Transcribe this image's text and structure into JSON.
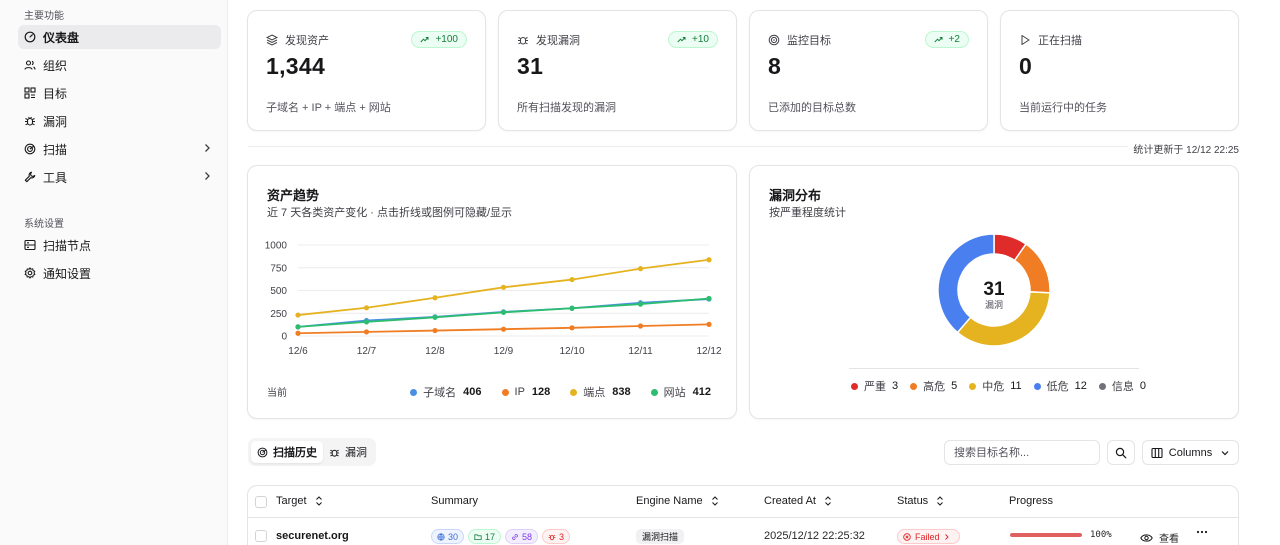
{
  "sidebar": {
    "section_main": "主要功能",
    "section_system": "系统设置",
    "items": [
      {
        "label": "仪表盘",
        "icon": "dashboard-icon"
      },
      {
        "label": "组织",
        "icon": "users-icon"
      },
      {
        "label": "目标",
        "icon": "grid-icon"
      },
      {
        "label": "漏洞",
        "icon": "bug-icon"
      },
      {
        "label": "扫描",
        "icon": "radar-icon"
      },
      {
        "label": "工具",
        "icon": "wrench-icon"
      }
    ],
    "system_items": [
      {
        "label": "扫描节点",
        "icon": "server-icon"
      },
      {
        "label": "通知设置",
        "icon": "gear-icon"
      }
    ]
  },
  "stats": [
    {
      "title": "发现资产",
      "value": "1,344",
      "desc": "子域名 + IP + 端点 + 网站",
      "badge": "+100",
      "icon": "layers-icon"
    },
    {
      "title": "发现漏洞",
      "value": "31",
      "desc": "所有扫描发现的漏洞",
      "badge": "+10",
      "icon": "bug-icon"
    },
    {
      "title": "监控目标",
      "value": "8",
      "desc": "已添加的目标总数",
      "badge": "+2",
      "icon": "target-icon"
    },
    {
      "title": "正在扫描",
      "value": "0",
      "desc": "当前运行中的任务",
      "icon": "play-icon"
    }
  ],
  "stats_updated": "统计更新于 12/12 22:25",
  "asset_trend": {
    "title": "资产趋势",
    "subtitle": "近 7 天各类资产变化 · 点击折线或图例可隐藏/显示",
    "current_label": "当前"
  },
  "vuln_dist": {
    "title": "漏洞分布",
    "subtitle": "按严重程度统计",
    "center_value": "31",
    "center_label": "漏洞"
  },
  "chart_data": [
    {
      "type": "line",
      "x": [
        "12/6",
        "12/7",
        "12/8",
        "12/9",
        "12/10",
        "12/11",
        "12/12"
      ],
      "ylim": [
        0,
        1000
      ],
      "yticks": [
        "0",
        "250",
        "500",
        "750",
        "1000"
      ],
      "grid": true,
      "legend_position": "bottom",
      "series": [
        {
          "name": "子域名",
          "current": "406",
          "color": "#4a90e2",
          "values": [
            100,
            170,
            210,
            265,
            305,
            365,
            406
          ]
        },
        {
          "name": "IP",
          "current": "128",
          "color": "#f07d23",
          "values": [
            30,
            45,
            60,
            75,
            90,
            110,
            128
          ]
        },
        {
          "name": "端点",
          "current": "838",
          "color": "#e5b320",
          "values": [
            230,
            310,
            420,
            535,
            620,
            740,
            838
          ]
        },
        {
          "name": "网站",
          "current": "412",
          "color": "#2dbd6e",
          "values": [
            100,
            155,
            205,
            260,
            305,
            350,
            412
          ]
        }
      ]
    },
    {
      "type": "pie",
      "donut": true,
      "legend_position": "bottom",
      "categories": [
        "严重",
        "高危",
        "中危",
        "低危",
        "信息"
      ],
      "values": [
        3,
        5,
        11,
        12,
        0
      ],
      "labels": [
        "3",
        "5",
        "11",
        "12",
        "0"
      ],
      "colors": [
        "#e02b2b",
        "#f07d23",
        "#e5b320",
        "#4a7ff0",
        "#71717a"
      ]
    }
  ],
  "toolbar": {
    "tab_history": "扫描历史",
    "tab_vulns": "漏洞",
    "search_placeholder": "搜索目标名称...",
    "columns_label": "Columns"
  },
  "table": {
    "headers": [
      "Target",
      "Summary",
      "Engine Name",
      "Created At",
      "Status",
      "Progress"
    ],
    "rows": [
      {
        "target": "securenet.org",
        "summary": [
          {
            "value": "30",
            "icon": "globe-icon",
            "color": "#3b6fd8",
            "bg": "#eef3fe",
            "border": "#c7d7fb"
          },
          {
            "value": "17",
            "icon": "folder-icon",
            "color": "#15803d",
            "bg": "#ecfdf3",
            "border": "#bbf7d0"
          },
          {
            "value": "58",
            "icon": "link-icon",
            "color": "#7c3aed",
            "bg": "#f3eefe",
            "border": "#ddd0fb"
          },
          {
            "value": "3",
            "icon": "bug-icon",
            "color": "#dc2626",
            "bg": "#fef2f2",
            "border": "#fecaca"
          }
        ],
        "engine": "漏洞扫描",
        "created_at": "2025/12/12 22:25:32",
        "status": "Failed",
        "progress": 1.0,
        "progress_label": "100%",
        "view_label": "查看"
      }
    ]
  }
}
